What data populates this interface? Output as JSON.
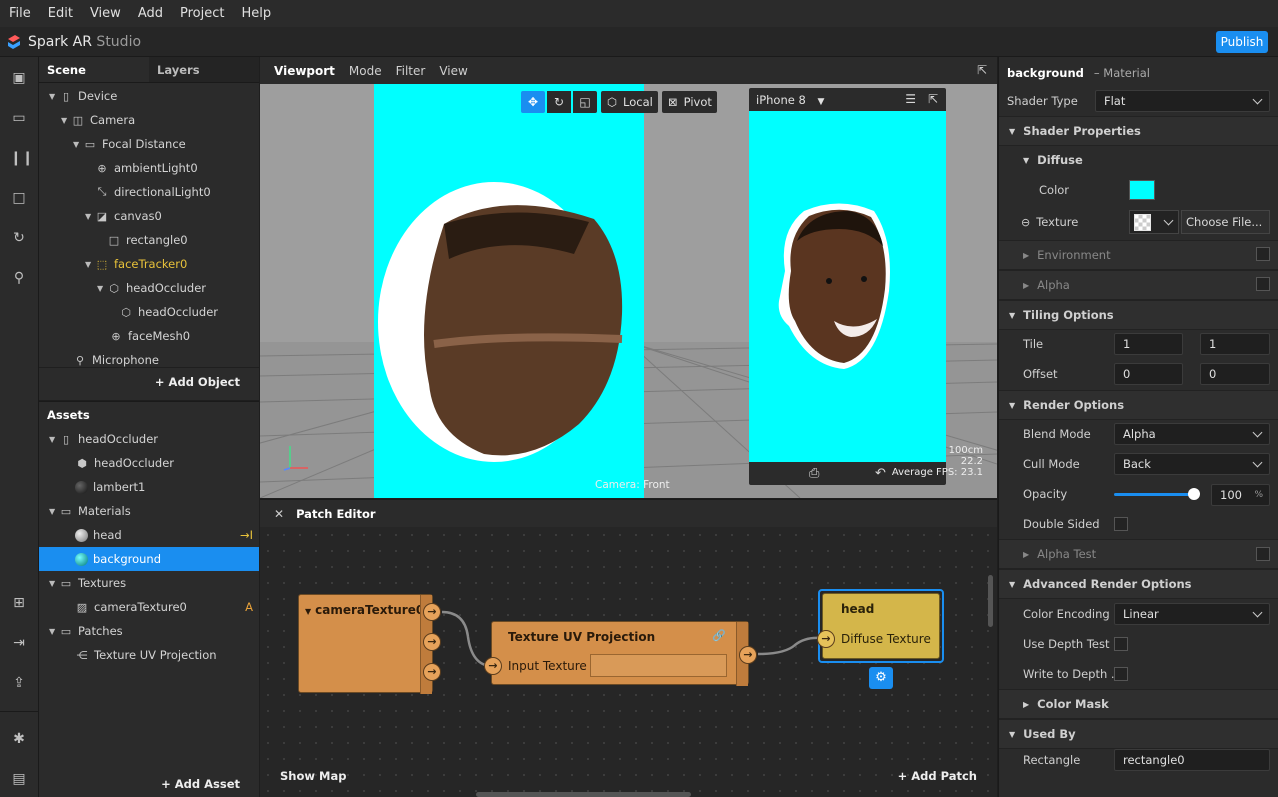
{
  "menu": [
    "File",
    "Edit",
    "View",
    "Add",
    "Project",
    "Help"
  ],
  "app": {
    "title_main": "Spark AR",
    "title_light": " Studio",
    "publish": "Publish"
  },
  "scene": {
    "tabs": [
      "Scene",
      "Layers"
    ],
    "items": [
      {
        "label": "Device",
        "icon": "phone-icon"
      },
      {
        "label": "Camera",
        "icon": "camera-icon"
      },
      {
        "label": "Focal Distance",
        "icon": "ruler-icon"
      },
      {
        "label": "ambientLight0",
        "icon": "globe-icon"
      },
      {
        "label": "directionalLight0",
        "icon": "directional-light-icon"
      },
      {
        "label": "canvas0",
        "icon": "canvas-icon"
      },
      {
        "label": "rectangle0",
        "icon": "rectangle-icon"
      },
      {
        "label": "faceTracker0",
        "icon": "face-tracker-icon"
      },
      {
        "label": "headOccluder",
        "icon": "cube-icon"
      },
      {
        "label": "headOccluder",
        "icon": "cube-icon"
      },
      {
        "label": "faceMesh0",
        "icon": "mesh-icon"
      },
      {
        "label": "Microphone",
        "icon": "microphone-icon"
      }
    ],
    "add_object": "+ Add Object"
  },
  "assets": {
    "title": "Assets",
    "items": [
      {
        "label": "headOccluder"
      },
      {
        "label": "headOccluder"
      },
      {
        "label": "lambert1"
      },
      {
        "label": "Materials"
      },
      {
        "label": "head",
        "badge": "→I"
      },
      {
        "label": "background"
      },
      {
        "label": "Textures"
      },
      {
        "label": "cameraTexture0",
        "badge": "A"
      },
      {
        "label": "Patches"
      },
      {
        "label": "Texture UV Projection"
      }
    ],
    "add_asset": "+ Add Asset"
  },
  "viewport": {
    "tabs": [
      "Viewport",
      "Mode",
      "Filter",
      "View"
    ],
    "local": "Local",
    "pivot": "Pivot",
    "device": "iPhone 8",
    "camera_label": "Camera: Front",
    "stats": [
      "100cm",
      "22.2",
      "Average FPS: 23.1"
    ]
  },
  "patch": {
    "title": "Patch Editor",
    "camera_texture": "cameraTexture0",
    "uv_title": "Texture UV Projection",
    "uv_input": "Input Texture",
    "head_title": "head",
    "head_input": "Diffuse Texture",
    "show_map": "Show Map",
    "add_patch": "+ Add Patch"
  },
  "inspector": {
    "name": "background",
    "type": "– Material",
    "shader_type_label": "Shader Type",
    "shader_type": "Flat",
    "shader_props": "Shader Properties",
    "diffuse": "Diffuse",
    "color": "Color",
    "color_value": "#00ffff",
    "texture": "Texture",
    "choose_file": "Choose File...",
    "environment": "Environment",
    "alpha": "Alpha",
    "tiling": "Tiling Options",
    "tile": "Tile",
    "tile_x": "1",
    "tile_y": "1",
    "offset": "Offset",
    "offset_x": "0",
    "offset_y": "0",
    "render": "Render Options",
    "blend_label": "Blend Mode",
    "blend": "Alpha",
    "cull_label": "Cull Mode",
    "cull": "Back",
    "opacity_label": "Opacity",
    "opacity": "100",
    "opacity_unit": "%",
    "opacity_fraction": 1.0,
    "double_sided": "Double Sided",
    "alpha_test": "Alpha Test",
    "advanced": "Advanced Render Options",
    "encoding_label": "Color Encoding",
    "encoding": "Linear",
    "depth_test": "Use Depth Test",
    "write_depth": "Write to Depth ...",
    "color_mask": "Color Mask",
    "used_by": "Used By",
    "rectangle_label": "Rectangle",
    "rectangle_value": "rectangle0"
  }
}
